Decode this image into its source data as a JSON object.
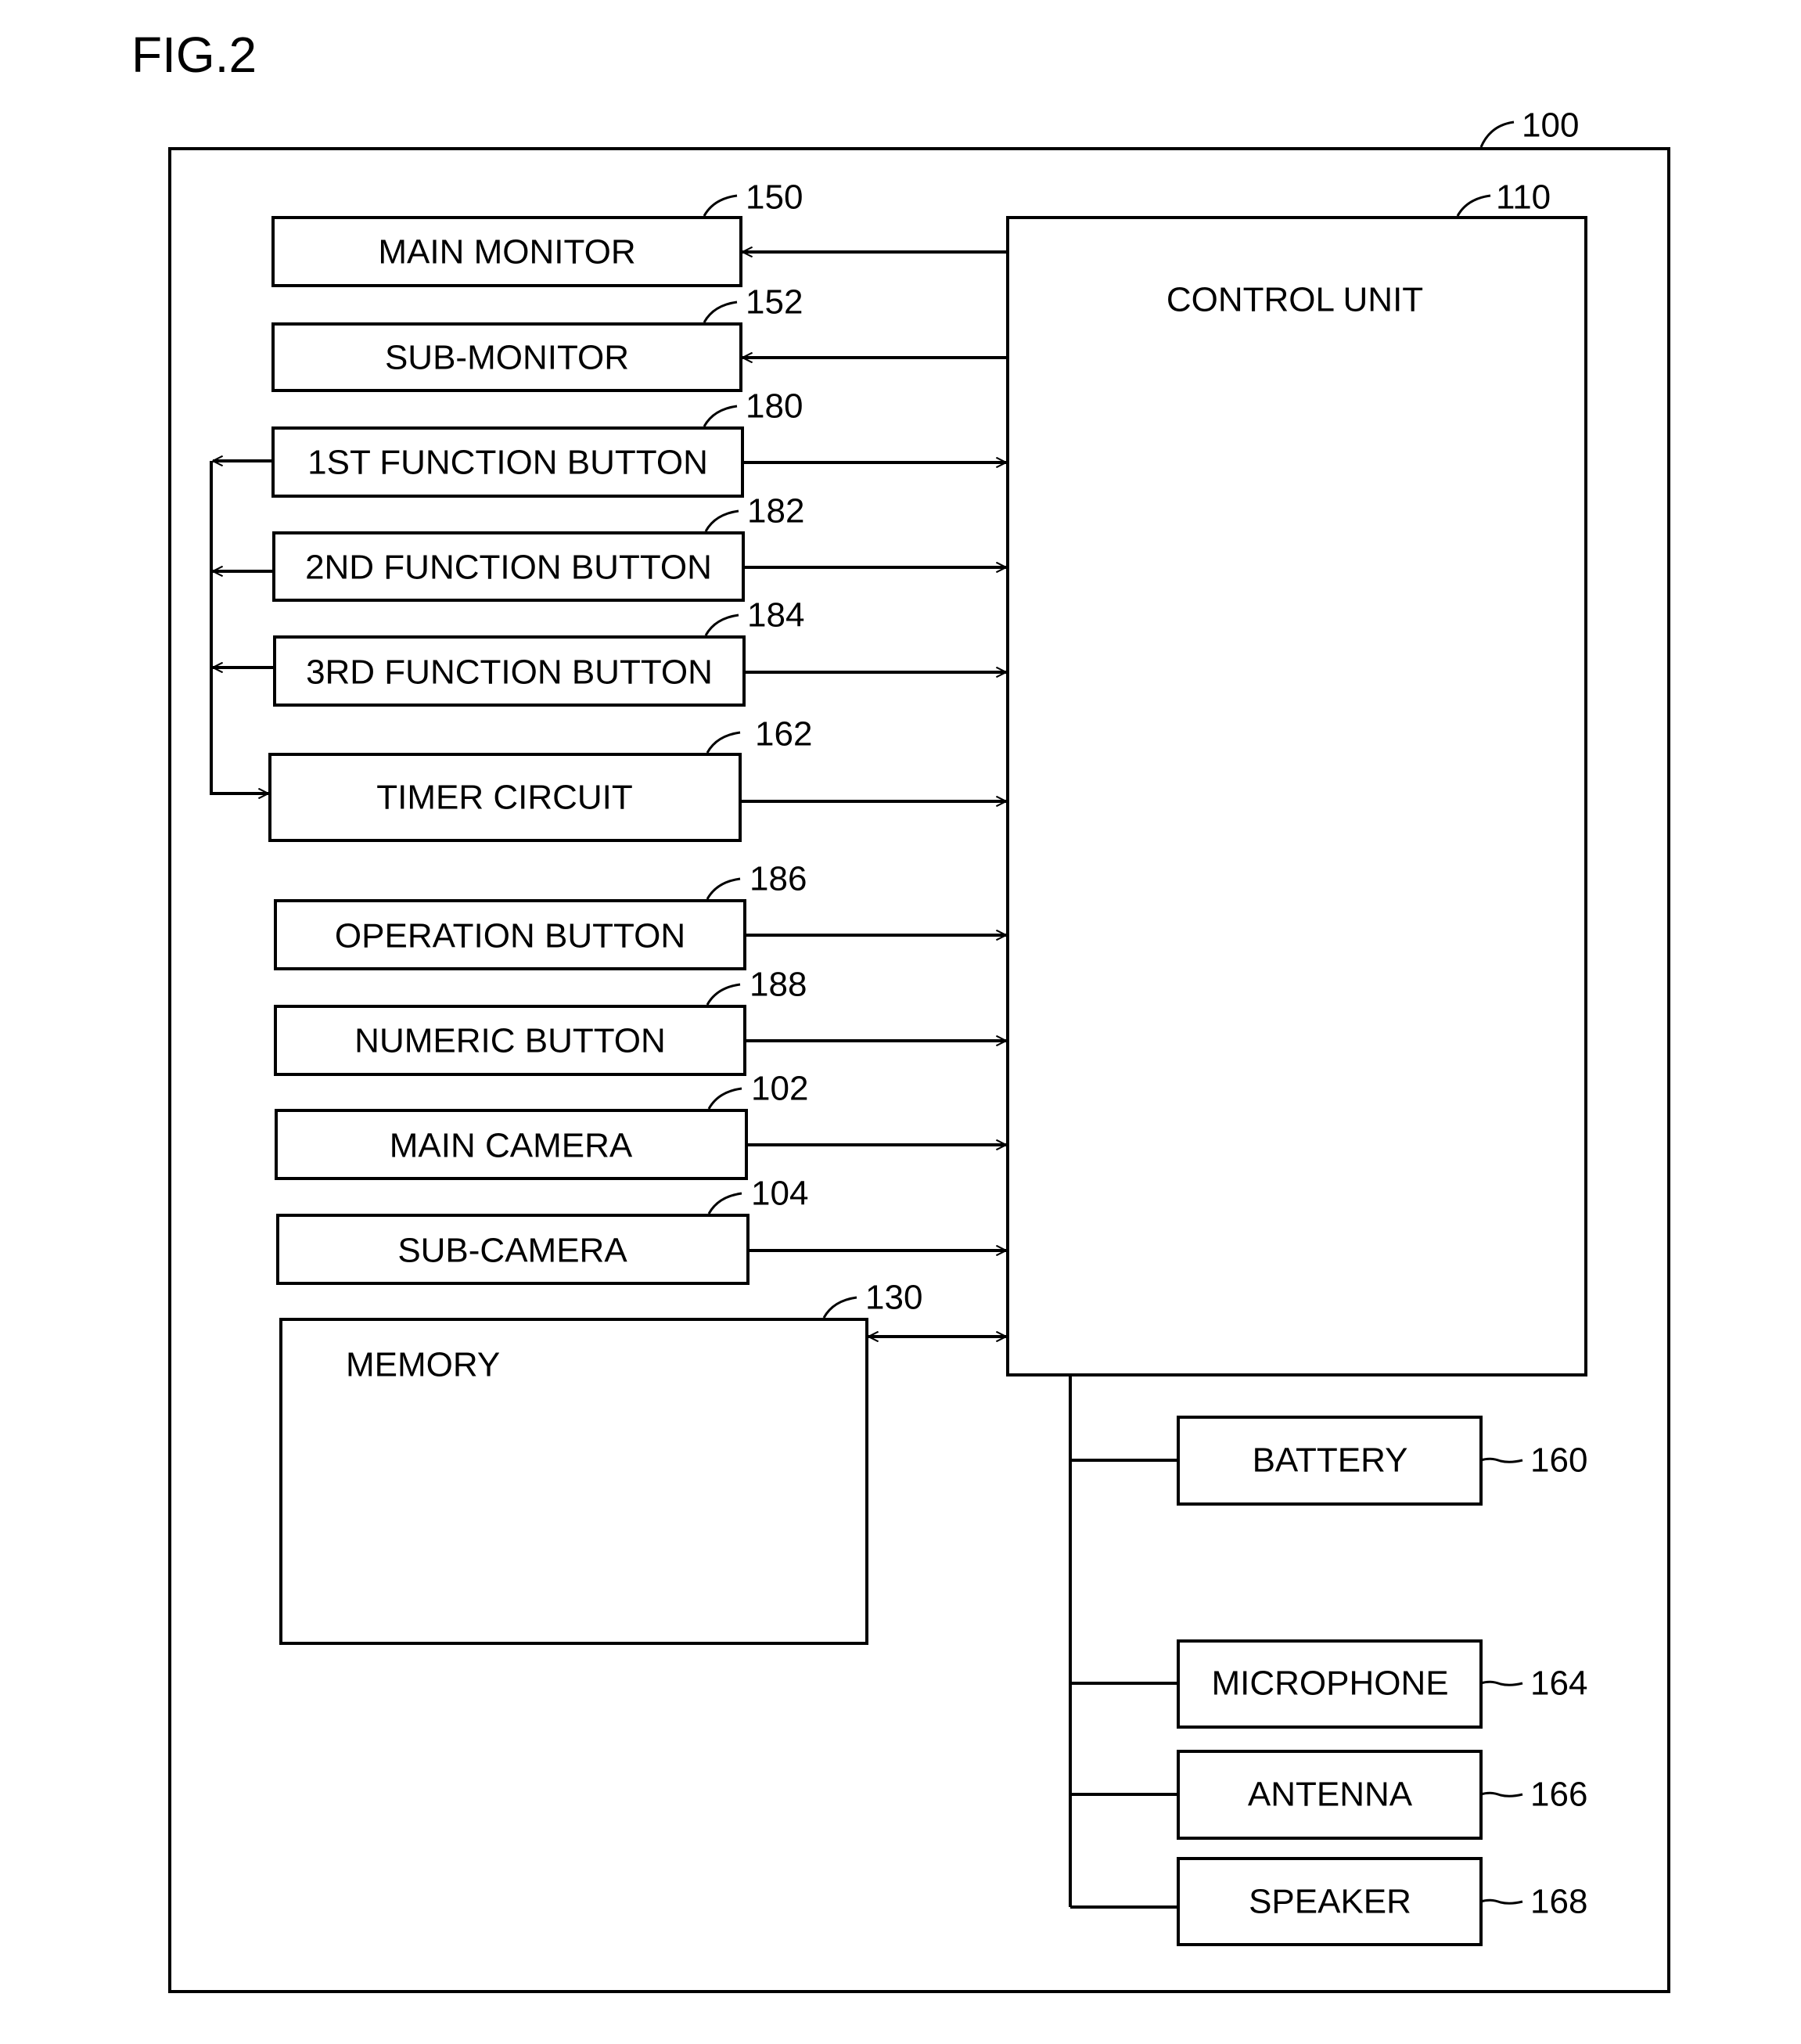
{
  "figure": {
    "title": "FIG.2",
    "device_ref": "100"
  },
  "control_unit": {
    "label": "CONTROL UNIT",
    "ref": "110"
  },
  "left_blocks": [
    {
      "id": "main-monitor",
      "label": "MAIN MONITOR",
      "ref": "150",
      "connection": "from-control"
    },
    {
      "id": "sub-monitor",
      "label": "SUB-MONITOR",
      "ref": "152",
      "connection": "from-control"
    },
    {
      "id": "1st-function-button",
      "label": "1ST FUNCTION BUTTON",
      "ref": "180",
      "connection": "to-control"
    },
    {
      "id": "2nd-function-button",
      "label": "2ND FUNCTION BUTTON",
      "ref": "182",
      "connection": "to-control"
    },
    {
      "id": "3rd-function-button",
      "label": "3RD FUNCTION BUTTON",
      "ref": "184",
      "connection": "to-control"
    },
    {
      "id": "timer-circuit",
      "label": "TIMER CIRCUIT",
      "ref": "162",
      "connection": "to-control"
    },
    {
      "id": "operation-button",
      "label": "OPERATION BUTTON",
      "ref": "186",
      "connection": "to-control"
    },
    {
      "id": "numeric-button",
      "label": "NUMERIC BUTTON",
      "ref": "188",
      "connection": "to-control"
    },
    {
      "id": "main-camera",
      "label": "MAIN CAMERA",
      "ref": "102",
      "connection": "to-control"
    },
    {
      "id": "sub-camera",
      "label": "SUB-CAMERA",
      "ref": "104",
      "connection": "to-control"
    }
  ],
  "memory": {
    "label": "MEMORY",
    "ref": "130",
    "connection": "bidirectional"
  },
  "right_blocks": [
    {
      "id": "battery",
      "label": "BATTERY",
      "ref": "160"
    },
    {
      "id": "microphone",
      "label": "MICROPHONE",
      "ref": "164"
    },
    {
      "id": "antenna",
      "label": "ANTENNA",
      "ref": "166"
    },
    {
      "id": "speaker",
      "label": "SPEAKER",
      "ref": "168"
    }
  ],
  "feedback_bus": {
    "from": [
      "1ST FUNCTION BUTTON",
      "2ND FUNCTION BUTTON",
      "3RD FUNCTION BUTTON"
    ],
    "to": "TIMER CIRCUIT"
  }
}
